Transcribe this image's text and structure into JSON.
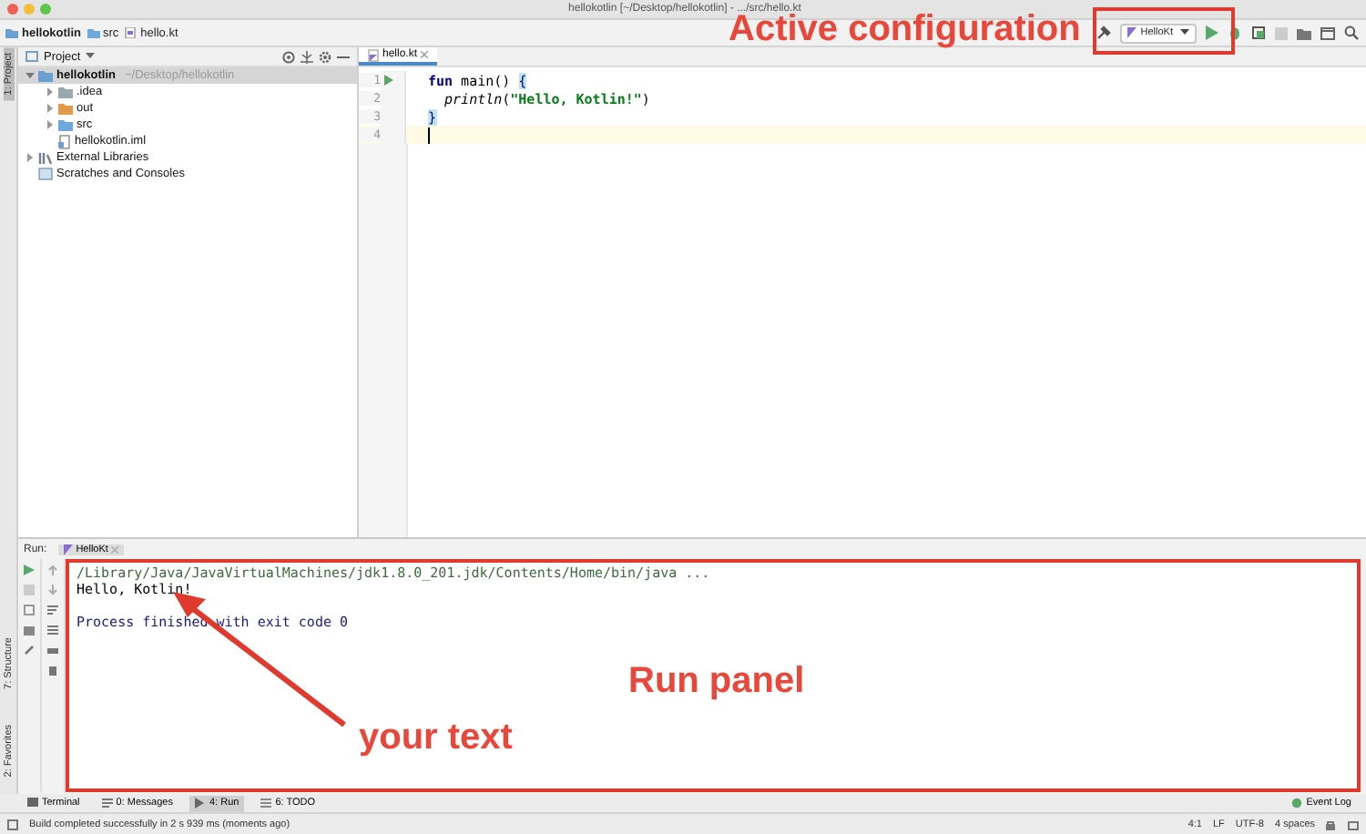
{
  "window": {
    "title": "hellokotlin [~/Desktop/hellokotlin] - .../src/hello.kt"
  },
  "breadcrumbs": [
    "hellokotlin",
    "src",
    "hello.kt"
  ],
  "run_configuration": {
    "name": "HelloKt"
  },
  "side_tabs": [
    {
      "label": "1: Project",
      "selected": true,
      "kind": "top"
    },
    {
      "label": "2: Favorites",
      "selected": false,
      "kind": "bottom"
    },
    {
      "label": "7: Structure",
      "selected": false,
      "kind": "bottom"
    }
  ],
  "project_panel": {
    "title": "Project",
    "tree": [
      {
        "label": "hellokotlin",
        "path": "~/Desktop/hellokotlin",
        "kind": "module",
        "expanded": true,
        "selected": true,
        "children": [
          {
            "label": ".idea",
            "kind": "folder",
            "expanded": false,
            "selected": false
          },
          {
            "label": "out",
            "kind": "excluded",
            "expanded": false,
            "selected": false
          },
          {
            "label": "src",
            "kind": "source",
            "expanded": false,
            "selected": false
          },
          {
            "label": "hellokotlin.iml",
            "kind": "file",
            "selected": false
          }
        ]
      },
      {
        "label": "External Libraries",
        "kind": "library",
        "expanded": false,
        "selected": false
      },
      {
        "label": "Scratches and Consoles",
        "kind": "scratch",
        "selected": false
      }
    ]
  },
  "editor": {
    "tabs": [
      {
        "label": "hello.kt",
        "selected": true
      }
    ],
    "lines": [
      {
        "number": "1",
        "runnable": true,
        "current": false,
        "tokens": [
          {
            "kind": "keyword",
            "text": "fun"
          },
          {
            "kind": "plain",
            "text": " main() "
          },
          {
            "kind": "brace",
            "text": "{"
          }
        ]
      },
      {
        "number": "2",
        "runnable": false,
        "current": false,
        "tokens": [
          {
            "kind": "call",
            "text": "  println"
          },
          {
            "kind": "plain",
            "text": "("
          },
          {
            "kind": "string",
            "text": "\"Hello, Kotlin!\""
          },
          {
            "kind": "plain",
            "text": ")"
          }
        ]
      },
      {
        "number": "3",
        "runnable": false,
        "current": false,
        "tokens": [
          {
            "kind": "brace",
            "text": "}"
          }
        ]
      },
      {
        "number": "4",
        "runnable": false,
        "current": true
      }
    ]
  },
  "run_panel": {
    "title": "Run:",
    "tabs": [
      {
        "label": "HelloKt",
        "selected": true
      }
    ],
    "console": [
      {
        "kind": "command",
        "text": "/Library/Java/JavaVirtualMachines/jdk1.8.0_201.jdk/Contents/Home/bin/java ..."
      },
      {
        "kind": "output",
        "text": "Hello, Kotlin!"
      },
      {
        "kind": "system",
        "text": "Process finished with exit code 0"
      }
    ]
  },
  "tool_tabs": [
    {
      "label": "Terminal",
      "selected": false
    },
    {
      "label": "0: Messages",
      "selected": false
    },
    {
      "label": "4: Run",
      "selected": true
    },
    {
      "label": "6: TODO",
      "selected": false
    }
  ],
  "event_log": "Event Log",
  "status_bar": {
    "message": "Build completed successfully in 2 s 939 ms (moments ago)",
    "position": "4:1",
    "line_separator": "LF",
    "encoding": "UTF-8",
    "indent": "4 spaces"
  },
  "annotations": [
    {
      "kind": "toolbar",
      "text": "Active configuration"
    },
    {
      "kind": "console",
      "text": "Run panel"
    },
    {
      "kind": "arrow",
      "text": "your text"
    }
  ]
}
